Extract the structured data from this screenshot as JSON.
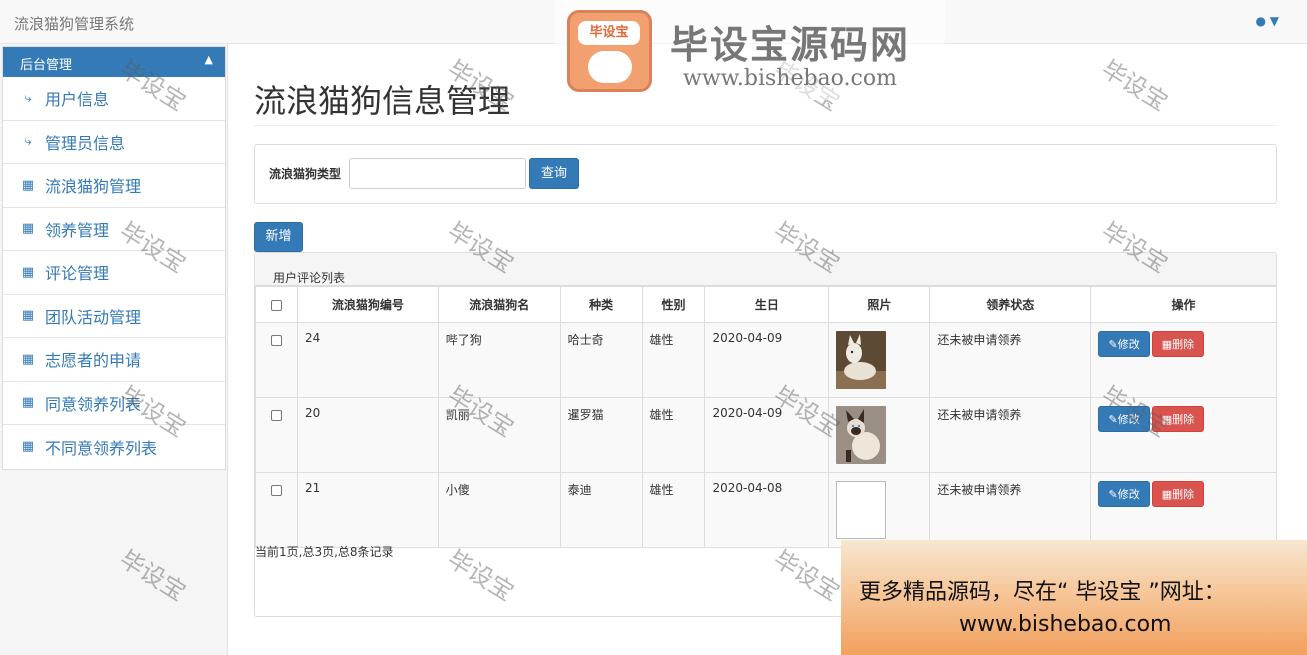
{
  "app": {
    "title": "流浪猫狗管理系统"
  },
  "sidebar": {
    "header": "后台管理",
    "items": [
      {
        "label": "用户信息",
        "icon": "bolt-icon"
      },
      {
        "label": "管理员信息",
        "icon": "bolt-icon"
      },
      {
        "label": "流浪猫狗管理",
        "icon": "sitemap-icon"
      },
      {
        "label": "领养管理",
        "icon": "sitemap-icon"
      },
      {
        "label": "评论管理",
        "icon": "sitemap-icon"
      },
      {
        "label": "团队活动管理",
        "icon": "sitemap-icon"
      },
      {
        "label": "志愿者的申请",
        "icon": "sitemap-icon"
      },
      {
        "label": "同意领养列表",
        "icon": "sitemap-icon"
      },
      {
        "label": "不同意领养列表",
        "icon": "sitemap-icon"
      }
    ]
  },
  "main": {
    "page_title": "流浪猫狗信息管理",
    "search": {
      "label": "流浪猫狗类型",
      "value": "",
      "button": "查询"
    },
    "add_button": "新增",
    "list_title": "用户评论列表",
    "columns": [
      "流浪猫狗编号",
      "流浪猫狗名",
      "种类",
      "性别",
      "生日",
      "照片",
      "领养状态",
      "操作"
    ],
    "rows": [
      {
        "id": "24",
        "name": "哔了狗",
        "kind": "哈士奇",
        "sex": "雄性",
        "birthday": "2020-04-09",
        "photo": "dog",
        "status": "还未被申请领养",
        "edit": "修改",
        "delete": "删除"
      },
      {
        "id": "20",
        "name": "凯丽",
        "kind": "暹罗猫",
        "sex": "雄性",
        "birthday": "2020-04-09",
        "photo": "cat",
        "status": "还未被申请领养",
        "edit": "修改",
        "delete": "删除"
      },
      {
        "id": "21",
        "name": "小傻",
        "kind": "泰迪",
        "sex": "雄性",
        "birthday": "2020-04-08",
        "photo": "broken",
        "status": "还未被申请领养",
        "edit": "修改",
        "delete": "删除"
      }
    ],
    "pagination": "当前1页,总3页,总8条记录"
  },
  "watermark": {
    "text": "毕设宝",
    "logo_title": "毕设宝源码网",
    "logo_badge": "毕设宝",
    "logo_url": "www.bishebao.com",
    "promo_line1": "更多精品源码，尽在“ 毕设宝 ”网址：",
    "promo_line2": "www.bishebao.com"
  },
  "colors": {
    "primary": "#337ab7",
    "danger": "#d9534f"
  }
}
